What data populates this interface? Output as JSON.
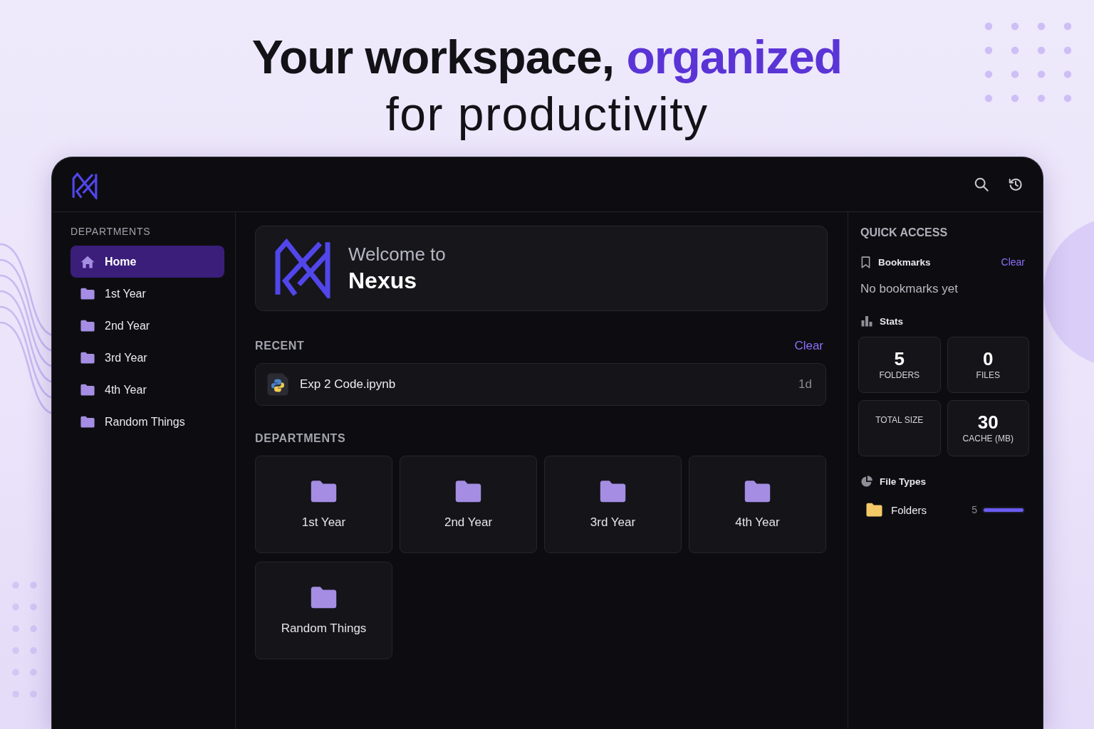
{
  "headline": {
    "text": "Your workspace,",
    "highlight": "organized",
    "second_line": "for productivity"
  },
  "sidebar": {
    "heading": "DEPARTMENTS",
    "items": [
      {
        "label": "Home",
        "kind": "home",
        "selected": true
      },
      {
        "label": "1st Year",
        "kind": "folder",
        "selected": false
      },
      {
        "label": "2nd Year",
        "kind": "folder",
        "selected": false
      },
      {
        "label": "3rd Year",
        "kind": "folder",
        "selected": false
      },
      {
        "label": "4th Year",
        "kind": "folder",
        "selected": false
      },
      {
        "label": "Random Things",
        "kind": "folder",
        "selected": false
      }
    ]
  },
  "welcome": {
    "greeting": "Welcome to",
    "title": "Nexus"
  },
  "recent": {
    "heading": "RECENT",
    "action": "Clear",
    "items": [
      {
        "name": "Exp 2 Code.ipynb",
        "age": "1d"
      }
    ]
  },
  "departments": {
    "heading": "DEPARTMENTS",
    "folders": [
      {
        "label": "1st Year"
      },
      {
        "label": "2nd Year"
      },
      {
        "label": "3rd Year"
      },
      {
        "label": "4th Year"
      },
      {
        "label": "Random Things"
      }
    ]
  },
  "quick_access": {
    "heading": "QUICK ACCESS",
    "bookmarks": {
      "title": "Bookmarks",
      "action": "Clear",
      "empty_text": "No bookmarks yet"
    },
    "stats": {
      "title": "Stats",
      "cards": [
        {
          "value": "5",
          "label": "FOLDERS"
        },
        {
          "value": "0",
          "label": "FILES"
        },
        {
          "label": "TOTAL SIZE"
        },
        {
          "value": "30",
          "label": "CACHE (MB)"
        }
      ]
    },
    "file_types": {
      "title": "File Types",
      "items": [
        {
          "label": "Folders",
          "count": "5",
          "level": 1
        }
      ]
    }
  }
}
